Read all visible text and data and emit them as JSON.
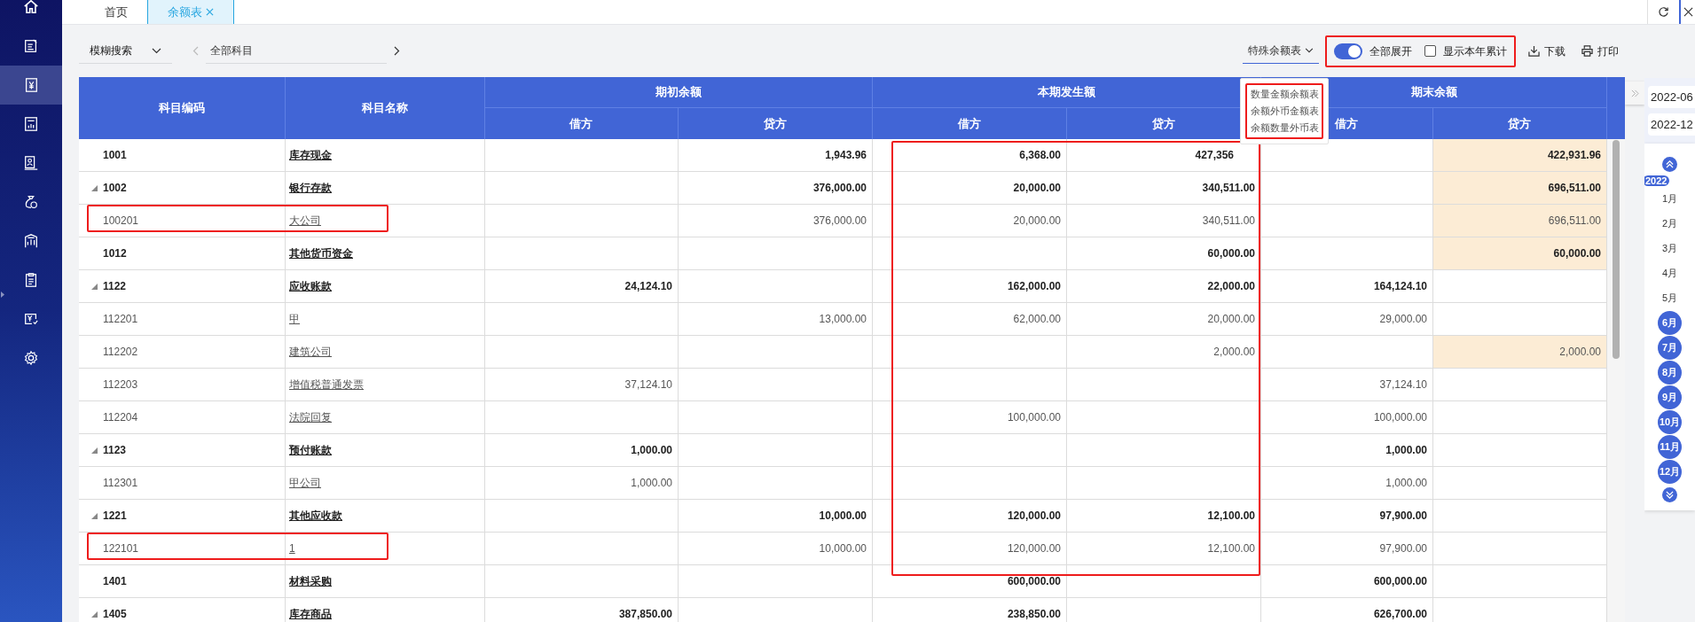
{
  "sidebar": {
    "items": [
      {
        "selected": false
      },
      {
        "selected": false
      },
      {
        "selected": true
      },
      {
        "selected": false
      },
      {
        "selected": false
      },
      {
        "selected": false
      },
      {
        "selected": false
      },
      {
        "selected": false
      },
      {
        "selected": false
      },
      {
        "selected": false
      }
    ]
  },
  "tabs": [
    {
      "label": "首页",
      "selected": false,
      "closable": false
    },
    {
      "label": "余额表",
      "selected": true,
      "closable": true
    }
  ],
  "toolbar": {
    "search_mode": "模糊搜索",
    "subject": "全部科目",
    "special_table": {
      "label": "特殊余额表",
      "open": true,
      "highlighted": true,
      "options": [
        "数量金额余额表",
        "余额外币金额表",
        "余额数量外币表"
      ]
    },
    "switches_highlighted": true,
    "expand_all": {
      "label": "全部展开",
      "on": true
    },
    "show_year_total": {
      "label": "显示本年累计",
      "checked": false
    },
    "download": "下载",
    "print": "打印"
  },
  "table": {
    "columns": [
      {
        "label": "科目编码"
      },
      {
        "label": "科目名称"
      },
      {
        "label": "期初余额",
        "highlighted": false,
        "children": [
          "借方",
          "贷方"
        ]
      },
      {
        "label": "本期发生额",
        "highlighted": true,
        "children": [
          "借方",
          "贷方"
        ]
      },
      {
        "label": "期末余额",
        "highlighted": false,
        "children": [
          "借方",
          "贷方"
        ]
      }
    ],
    "rows": [
      {
        "kind": "summary",
        "expandable": false,
        "highlighted": false,
        "code": "1001",
        "name": "库存现金",
        "values": {
          "opening_credit": "1,943.96",
          "period_debit": "6,368.00",
          "period_credit": "427,356",
          "closing_credit": "422,931.96"
        },
        "credit_balance_highlighted": true,
        "covered_by_menu": true
      },
      {
        "kind": "summary",
        "expandable": true,
        "highlighted": false,
        "code": "1002",
        "name": "银行存款",
        "values": {
          "opening_credit": "376,000.00",
          "period_debit": "20,000.00",
          "period_credit": "340,511.00",
          "closing_credit": "696,511.00"
        },
        "credit_balance_highlighted": true,
        "covered_by_menu": false
      },
      {
        "kind": "detail",
        "expandable": false,
        "highlighted": true,
        "code": "100201",
        "name": "大公司",
        "values": {
          "opening_credit": "376,000.00",
          "period_debit": "20,000.00",
          "period_credit": "340,511.00",
          "closing_credit": "696,511.00"
        },
        "credit_balance_highlighted": true,
        "covered_by_menu": false
      },
      {
        "kind": "summary",
        "expandable": false,
        "highlighted": false,
        "code": "1012",
        "name": "其他货币资金",
        "values": {
          "period_credit": "60,000.00",
          "closing_credit": "60,000.00"
        },
        "credit_balance_highlighted": true,
        "covered_by_menu": false
      },
      {
        "kind": "summary",
        "expandable": true,
        "highlighted": false,
        "code": "1122",
        "name": "应收账款",
        "values": {
          "opening_debit": "24,124.10",
          "period_debit": "162,000.00",
          "period_credit": "22,000.00",
          "closing_debit": "164,124.10"
        },
        "credit_balance_highlighted": false,
        "covered_by_menu": false
      },
      {
        "kind": "detail",
        "expandable": false,
        "highlighted": false,
        "code": "112201",
        "name": "甲",
        "values": {
          "opening_credit": "13,000.00",
          "period_debit": "62,000.00",
          "period_credit": "20,000.00",
          "closing_debit": "29,000.00"
        },
        "credit_balance_highlighted": false,
        "covered_by_menu": false
      },
      {
        "kind": "detail",
        "expandable": false,
        "highlighted": false,
        "code": "112202",
        "name": "建筑公司",
        "values": {
          "period_credit": "2,000.00",
          "closing_credit": "2,000.00"
        },
        "credit_balance_highlighted": true,
        "covered_by_menu": false
      },
      {
        "kind": "detail",
        "expandable": false,
        "highlighted": false,
        "code": "112203",
        "name": "增值税普通发票",
        "values": {
          "opening_debit": "37,124.10",
          "closing_debit": "37,124.10"
        },
        "credit_balance_highlighted": false,
        "covered_by_menu": false
      },
      {
        "kind": "detail",
        "expandable": false,
        "highlighted": false,
        "code": "112204",
        "name": "法院回复",
        "values": {
          "period_debit": "100,000.00",
          "closing_debit": "100,000.00"
        },
        "credit_balance_highlighted": false,
        "covered_by_menu": false
      },
      {
        "kind": "summary",
        "expandable": true,
        "highlighted": false,
        "code": "1123",
        "name": "预付账款",
        "values": {
          "opening_debit": "1,000.00",
          "closing_debit": "1,000.00"
        },
        "credit_balance_highlighted": false,
        "covered_by_menu": false
      },
      {
        "kind": "detail",
        "expandable": false,
        "highlighted": false,
        "code": "112301",
        "name": "甲公司",
        "values": {
          "opening_debit": "1,000.00",
          "closing_debit": "1,000.00"
        },
        "credit_balance_highlighted": false,
        "covered_by_menu": false
      },
      {
        "kind": "summary",
        "expandable": true,
        "highlighted": false,
        "code": "1221",
        "name": "其他应收款",
        "values": {
          "opening_credit": "10,000.00",
          "period_debit": "120,000.00",
          "period_credit": "12,100.00",
          "closing_debit": "97,900.00"
        },
        "credit_balance_highlighted": false,
        "covered_by_menu": false
      },
      {
        "kind": "detail",
        "expandable": false,
        "highlighted": true,
        "code": "122101",
        "name": "1",
        "values": {
          "opening_credit": "10,000.00",
          "period_debit": "120,000.00",
          "period_credit": "12,100.00",
          "closing_debit": "97,900.00"
        },
        "credit_balance_highlighted": false,
        "covered_by_menu": false
      },
      {
        "kind": "summary",
        "expandable": false,
        "highlighted": false,
        "code": "1401",
        "name": "材料采购",
        "values": {
          "period_debit": "600,000.00",
          "closing_debit": "600,000.00"
        },
        "credit_balance_highlighted": false,
        "covered_by_menu": false
      },
      {
        "kind": "summary",
        "expandable": true,
        "highlighted": false,
        "code": "1405",
        "name": "库存商品",
        "values": {
          "opening_debit": "387,850.00",
          "period_debit": "238,850.00",
          "closing_debit": "626,700.00"
        },
        "credit_balance_highlighted": false,
        "covered_by_menu": false
      }
    ]
  },
  "period_panel": {
    "start": "2022-06",
    "end": "2022-12",
    "year": "2022",
    "months": [
      {
        "label": "1月",
        "selected": false
      },
      {
        "label": "2月",
        "selected": false
      },
      {
        "label": "3月",
        "selected": false
      },
      {
        "label": "4月",
        "selected": false
      },
      {
        "label": "5月",
        "selected": false
      },
      {
        "label": "6月",
        "selected": true
      },
      {
        "label": "7月",
        "selected": true
      },
      {
        "label": "8月",
        "selected": true
      },
      {
        "label": "9月",
        "selected": true
      },
      {
        "label": "10月",
        "selected": true
      },
      {
        "label": "11月",
        "selected": true
      },
      {
        "label": "12月",
        "selected": true
      }
    ]
  }
}
